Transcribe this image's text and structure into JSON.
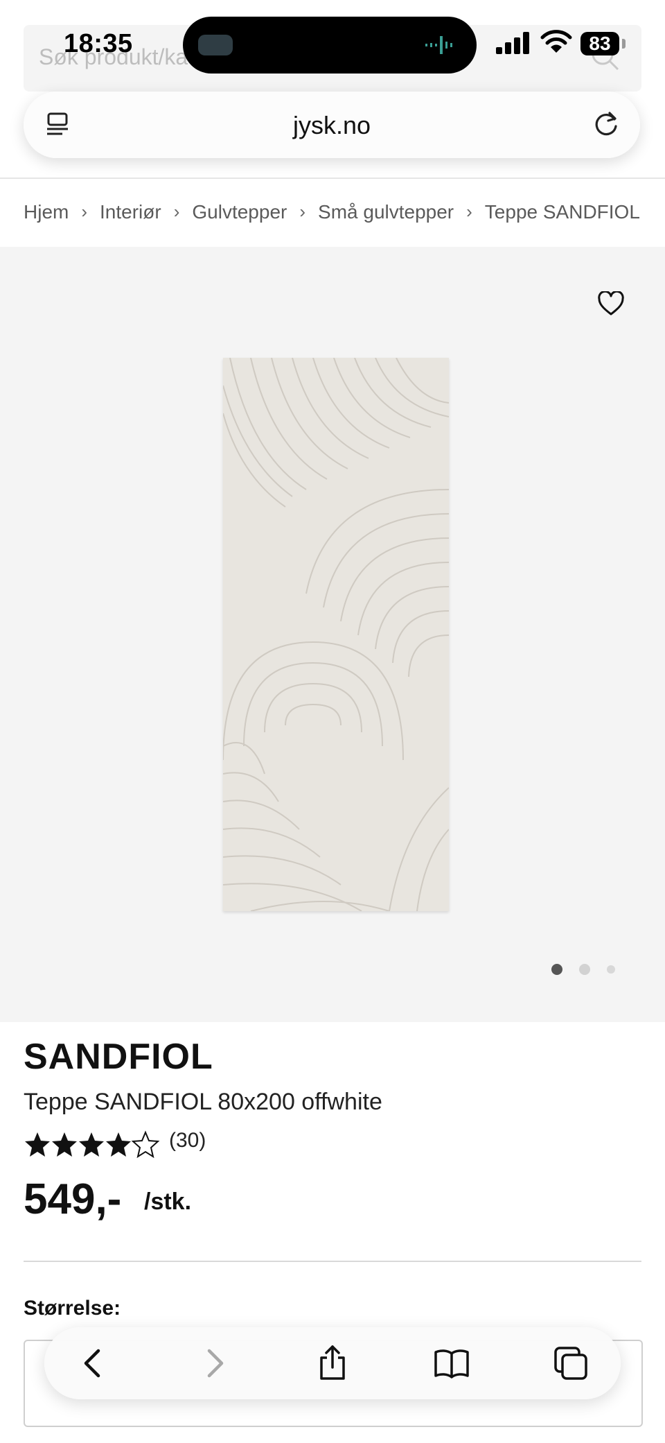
{
  "status_bar": {
    "time": "18:35",
    "battery": "83"
  },
  "browser": {
    "url": "jysk.no",
    "search_placeholder_behind": "Søk produkt/ka"
  },
  "breadcrumb": [
    {
      "label": "Hjem"
    },
    {
      "label": "Interiør"
    },
    {
      "label": "Gulvtepper"
    },
    {
      "label": "Små gulvtepper"
    },
    {
      "label": "Teppe SANDFIOL"
    }
  ],
  "gallery": {
    "slides": 3,
    "active_slide": 1
  },
  "product": {
    "brand": "SANDFIOL",
    "name": "Teppe SANDFIOL 80x200 offwhite",
    "rating": 4,
    "rating_max": 5,
    "review_count": "(30)",
    "price": "549,-",
    "unit": "/stk.",
    "size_label": "Størrelse:"
  },
  "icons": {
    "search": "search-icon",
    "menu": "page-menu-icon",
    "reload": "reload-icon",
    "heart": "heart-icon",
    "back": "chevron-left-icon",
    "forward": "chevron-right-icon",
    "share": "share-icon",
    "bookmarks": "book-icon",
    "tabs": "tabs-icon"
  },
  "colors": {
    "gallery_bg": "#f4f4f4",
    "rug": "#e6e3dd",
    "text": "#111111"
  }
}
